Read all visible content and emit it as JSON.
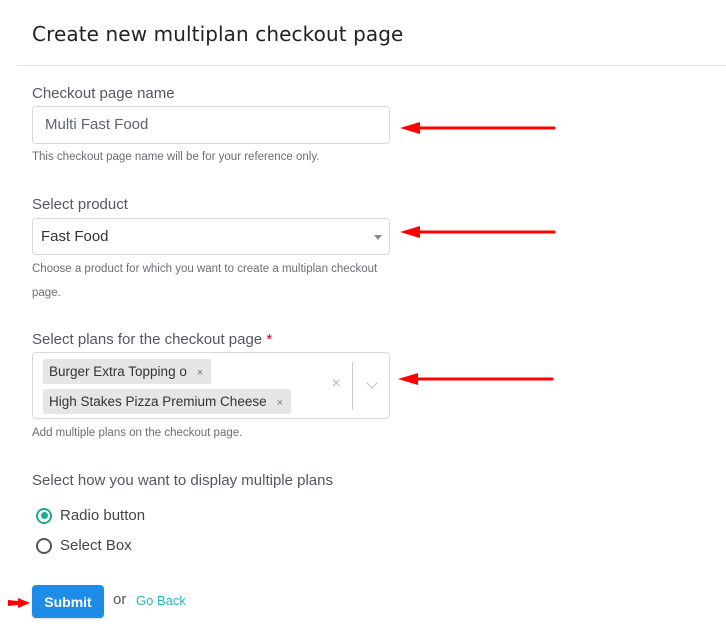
{
  "page": {
    "title": "Create new multiplan checkout page"
  },
  "form": {
    "checkout_name": {
      "label": "Checkout page name",
      "value": "Multi Fast Food",
      "help": "This checkout page name will be for your reference only."
    },
    "product": {
      "label": "Select product",
      "selected": "Fast Food",
      "help": "Choose a product for which you want to create a multiplan checkout page."
    },
    "plans": {
      "label": "Select plans for the checkout page",
      "required_mark": "*",
      "chips": [
        {
          "label": "Burger Extra Topping o",
          "remove": "×"
        },
        {
          "label": "High Stakes Pizza Premium Cheese",
          "remove": "×"
        }
      ],
      "clear": "×",
      "help": "Add multiple plans on the checkout page."
    },
    "display": {
      "label": "Select how you want to display multiple plans",
      "options": [
        {
          "label": "Radio button",
          "checked": true
        },
        {
          "label": "Select Box",
          "checked": false
        }
      ]
    },
    "actions": {
      "submit": "Submit",
      "or": "or",
      "go_back": "Go Back"
    }
  },
  "colors": {
    "primary": "#1e8ce6",
    "accent_radio": "#1fa98f",
    "link": "#26b4c3",
    "annotation_arrow": "#ff0000",
    "required": "#d0021b"
  }
}
